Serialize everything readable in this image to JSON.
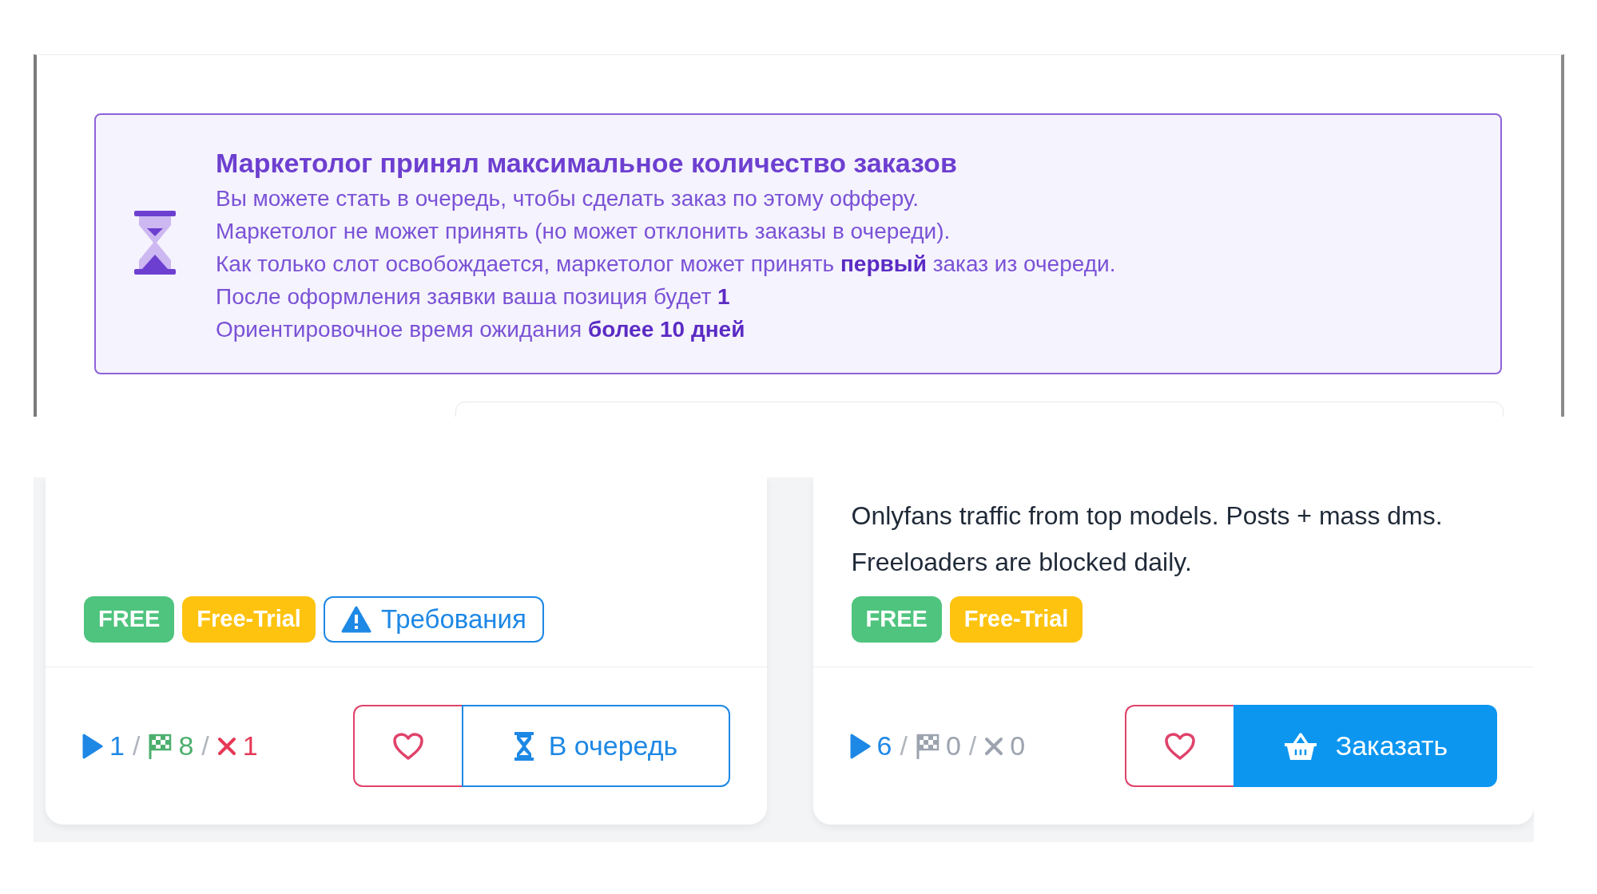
{
  "notice": {
    "title": "Маркетолог принял максимальное количество заказов",
    "lines": [
      "Вы можете стать в очередь, чтобы сделать заказ по этому офферу.",
      "Маркетолог не может принять (но может отклонить заказы в очереди).",
      "Как только слот освобождается, маркетолог может принять **первый** заказ из очереди.",
      "После оформления заявки ваша позиция будет **1**",
      "Ориентировочное время ожидания **более 10 дней**"
    ]
  },
  "offers": [
    {
      "tags": [
        {
          "kind": "free",
          "label": "FREE"
        },
        {
          "kind": "trial",
          "label": "Free-Trial"
        },
        {
          "kind": "requirements",
          "label": "Требования"
        }
      ],
      "stats": [
        {
          "kind": "started",
          "value": "1",
          "color": "#1e88e5"
        },
        {
          "kind": "finished",
          "value": "8",
          "color": "#4caf6e"
        },
        {
          "kind": "rejected",
          "value": "1",
          "color": "#e53956"
        }
      ],
      "separator": "/",
      "action": {
        "kind": "queue",
        "label": "В очередь"
      }
    },
    {
      "description": "Onlyfans traffic from top models. Posts + mass dms. Freeloaders are blocked daily.",
      "tags": [
        {
          "kind": "free",
          "label": "FREE"
        },
        {
          "kind": "trial",
          "label": "Free-Trial"
        }
      ],
      "stats": [
        {
          "kind": "started",
          "value": "6",
          "color": "#1e88e5"
        },
        {
          "kind": "finished",
          "value": "0",
          "color": "#9ca3af"
        },
        {
          "kind": "rejected",
          "value": "0",
          "color": "#9ca3af"
        }
      ],
      "separator": "/",
      "action": {
        "kind": "order",
        "label": "Заказать"
      }
    }
  ]
}
